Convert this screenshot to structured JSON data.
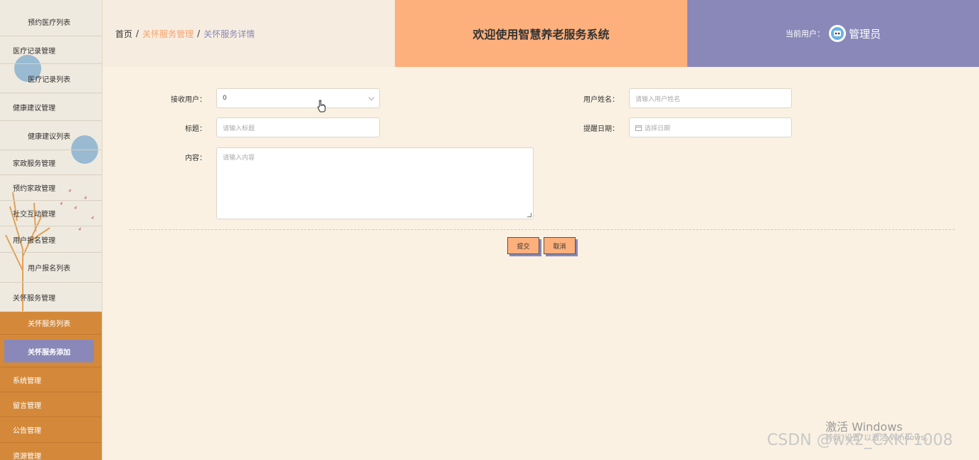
{
  "sidebar": {
    "items": [
      {
        "label": "预约医疗列表",
        "kind": "child"
      },
      {
        "label": "医疗记录管理",
        "kind": "parent"
      },
      {
        "label": "医疗记录列表",
        "kind": "child"
      },
      {
        "label": "健康建议管理",
        "kind": "parent"
      },
      {
        "label": "健康建议列表",
        "kind": "child"
      },
      {
        "label": "家政服务管理",
        "kind": "parent"
      },
      {
        "label": "预约家政管理",
        "kind": "parent"
      },
      {
        "label": "社交互动管理",
        "kind": "parent"
      },
      {
        "label": "用户报名管理",
        "kind": "parent"
      },
      {
        "label": "用户报名列表",
        "kind": "child"
      },
      {
        "label": "关怀服务管理",
        "kind": "parent"
      },
      {
        "label": "关怀服务列表",
        "kind": "child"
      },
      {
        "label": "关怀服务添加",
        "kind": "child-active"
      },
      {
        "label": "系统管理",
        "kind": "parent"
      },
      {
        "label": "留言管理",
        "kind": "parent"
      },
      {
        "label": "公告管理",
        "kind": "parent"
      },
      {
        "label": "资源管理",
        "kind": "parent"
      }
    ],
    "accent_color": "#d4893a",
    "active_color": "#8a88b8"
  },
  "header": {
    "breadcrumb": {
      "home": "首页",
      "separator": "/",
      "section": "关怀服务管理",
      "current": "关怀服务详情"
    },
    "welcome": "欢迎使用智慧养老服务系统",
    "user_label": "当前用户：",
    "user_name": "管理员",
    "colors": {
      "breadcrumb_bg": "#f7ece0",
      "welcome_bg": "#fdb07c",
      "user_bg": "#8a88b8"
    }
  },
  "form": {
    "receiver": {
      "label": "接收用户：",
      "value": "0"
    },
    "username": {
      "label": "用户姓名：",
      "placeholder": "请输入用户姓名"
    },
    "title": {
      "label": "标题：",
      "placeholder": "请输入标题"
    },
    "remind_date": {
      "label": "提醒日期：",
      "placeholder": "选择日期",
      "icon": "calendar-icon"
    },
    "content": {
      "label": "内容：",
      "placeholder": "请输入内容"
    },
    "submit_label": "提交",
    "cancel_label": "取消"
  },
  "watermarks": {
    "windows_title": "激活 Windows",
    "windows_sub": "转到\"设置\"以激活 Windows。",
    "csdn": "CSDN @wx2_CXKF1008"
  }
}
